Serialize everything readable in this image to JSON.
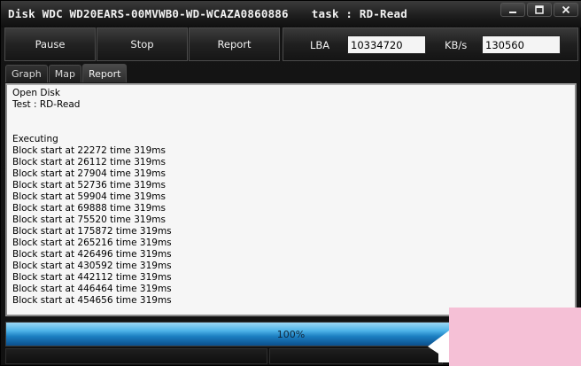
{
  "window": {
    "title": "Disk WDC WD20EARS-00MVWB0-WD-WCAZA0860886",
    "task": "task : RD-Read"
  },
  "toolbar": {
    "pause_label": "Pause",
    "stop_label": "Stop",
    "report_label": "Report",
    "lba_label": "LBA",
    "lba_value": "10334720",
    "kbs_label": "KB/s",
    "kbs_value": "130560"
  },
  "tabs": [
    {
      "label": "Graph",
      "active": false
    },
    {
      "label": "Map",
      "active": false
    },
    {
      "label": "Report",
      "active": true
    }
  ],
  "report": {
    "lines": [
      "Open Disk",
      "Test : RD-Read",
      "",
      "",
      "Executing",
      "Block start at 22272 time 319ms",
      "Block start at 26112 time 319ms",
      "Block start at 27904 time 319ms",
      "Block start at 52736 time 319ms",
      "Block start at 59904 time 319ms",
      "Block start at 69888 time 319ms",
      "Block start at 75520 time 319ms",
      "Block start at 175872 time 319ms",
      "Block start at 265216 time 319ms",
      "Block start at 426496 time 319ms",
      "Block start at 430592 time 319ms",
      "Block start at 442112 time 319ms",
      "Block start at 446464 time 319ms",
      "Block start at 454656 time 319ms"
    ]
  },
  "progress": {
    "label": "100%",
    "fraction": 1.0
  },
  "colors": {
    "progress_light": "#9ad7f5",
    "progress_dark": "#0b4f8c",
    "panel_bg": "#f6f6f6",
    "chrome_bg": "#151515"
  },
  "icons": {
    "minimize": "minimize-icon",
    "maximize": "maximize-icon",
    "close": "close-icon"
  }
}
